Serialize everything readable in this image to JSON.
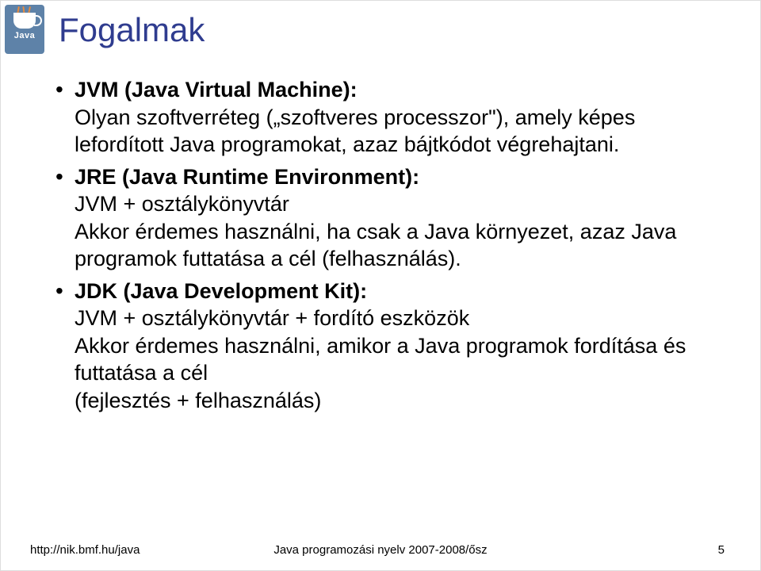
{
  "logo": {
    "text": "Java"
  },
  "title": "Fogalmak",
  "items": [
    {
      "bold": "JVM (Java Virtual Machine):",
      "rest": "Olyan szoftverréteg („szoftveres processzor\"), amely képes lefordított Java programokat, azaz bájtkódot végrehajtani."
    },
    {
      "bold": "JRE (Java Runtime Environment):",
      "rest": "JVM + osztálykönyvtár\nAkkor érdemes használni, ha csak a Java környezet, azaz Java programok futtatása a cél (felhasználás)."
    },
    {
      "bold": "JDK (Java Development Kit):",
      "rest": "JVM + osztálykönyvtár + fordító eszközök\nAkkor érdemes használni, amikor a Java programok fordítása és futtatása a cél\n(fejlesztés + felhasználás)"
    }
  ],
  "footer": {
    "left": "http://nik.bmf.hu/java",
    "center": "Java programozási nyelv 2007-2008/ősz",
    "right": "5"
  }
}
